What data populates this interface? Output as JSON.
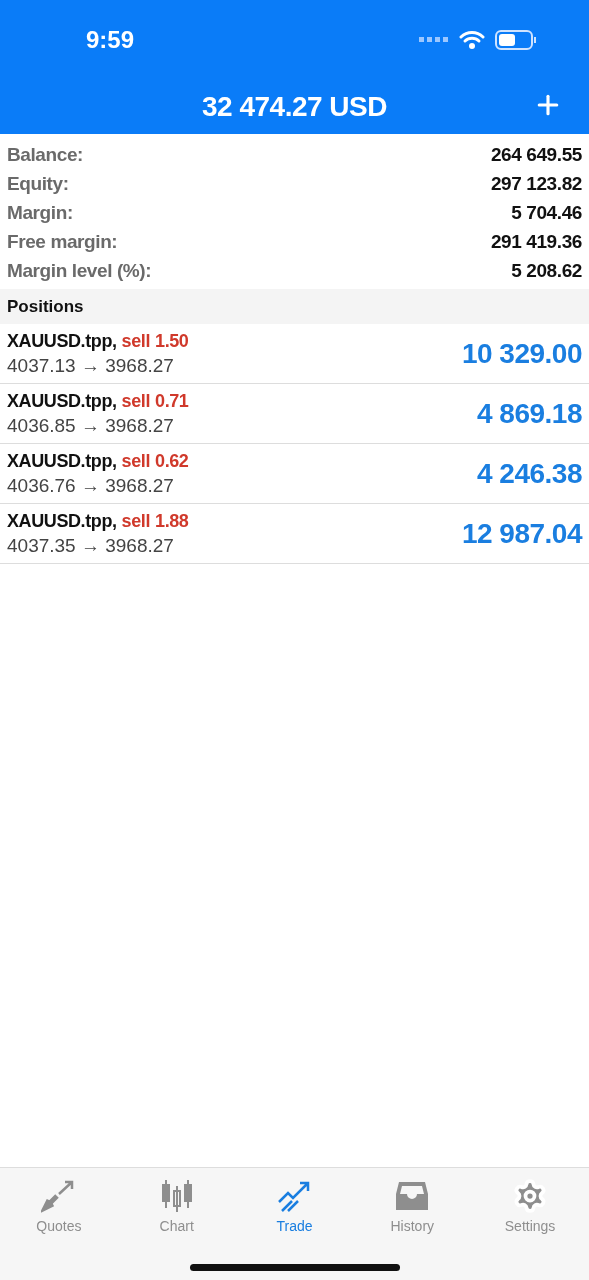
{
  "status_bar": {
    "time": "9:59"
  },
  "header": {
    "title": "32 474.27 USD"
  },
  "summary": [
    {
      "label": "Balance:",
      "value": "264 649.55"
    },
    {
      "label": "Equity:",
      "value": "297 123.82"
    },
    {
      "label": "Margin:",
      "value": "5 704.46"
    },
    {
      "label": "Free margin:",
      "value": "291 419.36"
    },
    {
      "label": "Margin level (%):",
      "value": "5 208.62"
    }
  ],
  "positions": {
    "title": "Positions",
    "rows": [
      {
        "symbol": "XAUUSD.tpp,",
        "side": "sell",
        "volume": "1.50",
        "prices": "4037.13 → 3968.27",
        "profit": "10 329.00"
      },
      {
        "symbol": "XAUUSD.tpp,",
        "side": "sell",
        "volume": "0.71",
        "prices": "4036.85 → 3968.27",
        "profit": "4 869.18"
      },
      {
        "symbol": "XAUUSD.tpp,",
        "side": "sell",
        "volume": "0.62",
        "prices": "4036.76 → 3968.27",
        "profit": "4 246.38"
      },
      {
        "symbol": "XAUUSD.tpp,",
        "side": "sell",
        "volume": "1.88",
        "prices": "4037.35 → 3968.27",
        "profit": "12 987.04"
      }
    ]
  },
  "tabs": [
    {
      "kind": "quotes",
      "label": "Quotes",
      "selected": false
    },
    {
      "kind": "chart",
      "label": "Chart",
      "selected": false
    },
    {
      "kind": "trade",
      "label": "Trade",
      "selected": true
    },
    {
      "kind": "history",
      "label": "History",
      "selected": false
    },
    {
      "kind": "settings",
      "label": "Settings",
      "selected": false
    }
  ]
}
